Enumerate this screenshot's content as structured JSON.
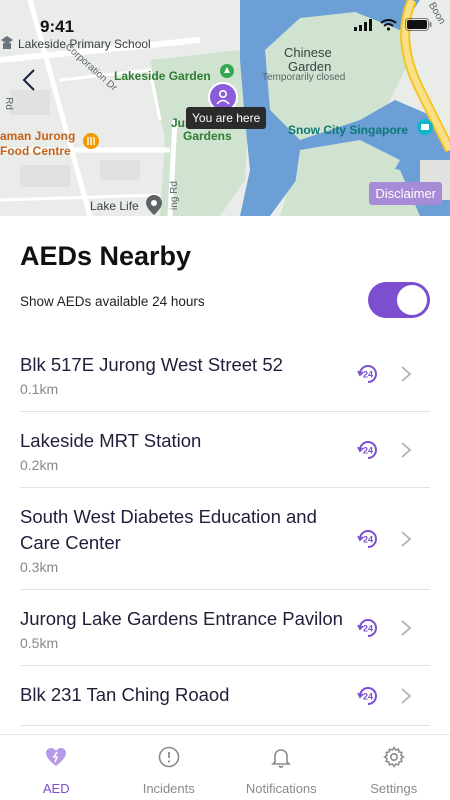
{
  "status_bar": {
    "time": "9:41"
  },
  "map": {
    "labels": {
      "school": "Lakeside Primary School",
      "corporation_dr": "Corporation Dr",
      "lakeside_garden": "Lakeside Garden",
      "chinese_garden": "Chinese",
      "chinese_garden_2": "Garden",
      "temporarily_closed": "Temporarily closed",
      "snow_city": "Snow City Singapore",
      "jurong_gardens_1": "Jur",
      "jurong_gardens_2": "Gardens",
      "food_centre_1": "aman Jurong",
      "food_centre_2": "Food Centre",
      "lake_life": "Lake Life",
      "rd_left": "Rd",
      "ching_rd": "ing Rd",
      "boon": "Boon"
    },
    "you_are_here": "You are here",
    "disclaimer": "Disclaimer"
  },
  "sheet": {
    "title": "AEDs Nearby",
    "toggle_label": "Show AEDs available 24 hours",
    "toggle_on": true,
    "accent": "#7b4fd0",
    "items": [
      {
        "name": "Blk 517E Jurong West Street 52",
        "distance": "0.1km"
      },
      {
        "name": "Lakeside MRT Station",
        "distance": "0.2km"
      },
      {
        "name": "South West Diabetes Education and Care Center",
        "distance": "0.3km"
      },
      {
        "name": "Jurong Lake Gardens Entrance Pavilon",
        "distance": "0.5km"
      },
      {
        "name": "Blk 231 Tan Ching Roaod",
        "distance": ""
      }
    ]
  },
  "tabs": [
    {
      "label": "AED",
      "icon": "heart-bolt-icon",
      "active": true
    },
    {
      "label": "Incidents",
      "icon": "alert-circle-icon",
      "active": false
    },
    {
      "label": "Notifications",
      "icon": "bell-icon",
      "active": false
    },
    {
      "label": "Settings",
      "icon": "gear-icon",
      "active": false
    }
  ]
}
